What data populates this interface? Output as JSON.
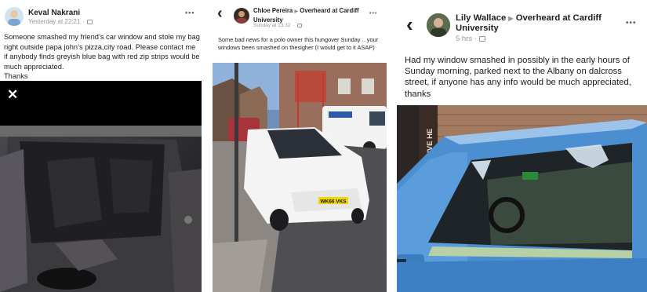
{
  "posts": [
    {
      "author": "Keval Nakrani",
      "timestamp": "Yesterday at 22:21",
      "privacy_icon": "globe-icon",
      "more_label": "•••",
      "text": "Someone smashed my friend’s car window and stole my bag right outside papa john’s pizza,city road. Please contact me if anybody finds greyish blue bag with red zip strips would be much appreciated.\nThanks",
      "close_label": "✕"
    },
    {
      "back_label": "‹",
      "author": "Chloe Pereira",
      "arrow": "▶",
      "group": "Overheard at Cardiff University",
      "timestamp": "Sunday at 13:32",
      "privacy_icon": "group-icon",
      "more_label": "•••",
      "text": "Some bad news for a polo owner this hungover Sunday .. your windows been smashed on thesigher (I would get to it ASAP)",
      "plate": "WK66 VKS"
    },
    {
      "back_label": "‹",
      "author": "Lily Wallace",
      "arrow": "▶",
      "group": "Overheard at Cardiff University",
      "timestamp": "5 hrs",
      "privacy_icon": "group-icon",
      "more_label": "•••",
      "text": "Had my window smashed in possibly in the early hours of Sunday morning, parked next to the Albany on dalcross street, if anyone has any info would be much appreciated, thanks",
      "sign_text": "WATCH THE LIVE HE"
    }
  ]
}
